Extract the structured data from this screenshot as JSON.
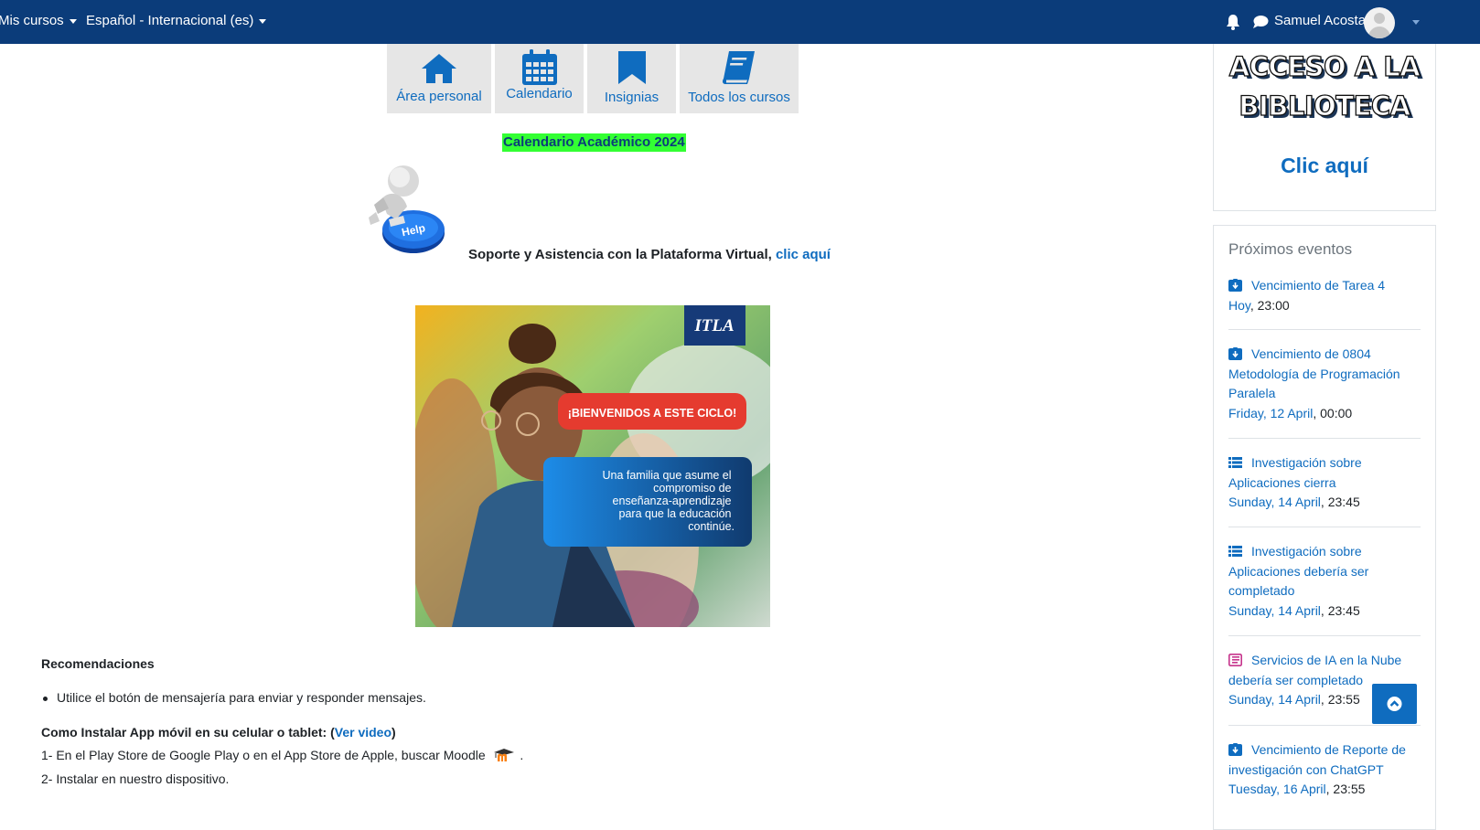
{
  "navbar": {
    "my_courses": "Mis cursos",
    "language": "Español - Internacional (es)",
    "user_name": "Samuel Acosta"
  },
  "quick_links": [
    {
      "label": "Área personal",
      "icon": "home-icon"
    },
    {
      "label": "Calendario",
      "icon": "calendar-icon"
    },
    {
      "label": "Insignias",
      "icon": "bookmark-icon"
    },
    {
      "label": "Todos los cursos",
      "icon": "book-icon"
    }
  ],
  "calendar_link": "Calendario Académico 2024",
  "support": {
    "help_badge": "Help",
    "text": "Soporte y Asistencia con la Plataforma Virtual,",
    "link": "clic aquí"
  },
  "banner": {
    "logo": "ITLA",
    "welcome": "¡BIENVENIDOS A ESTE CICLO!",
    "tagline_lines": [
      "Una familia que asume el",
      "compromiso de",
      "enseñanza-aprendizaje",
      "para que la educación",
      "continúe."
    ]
  },
  "recommendations": {
    "heading": "Recomendaciones",
    "items": [
      "Utilice el botón de mensajería para enviar y responder mensajes."
    ],
    "app_heading_prefix": "Como Instalar App móvil en su celular o tablet: (",
    "app_heading_link": "Ver video",
    "app_heading_suffix": ")",
    "step1": "1- En el Play Store de Google Play o en el App Store de Apple, buscar Moodle",
    "step1_end": ".",
    "step2": "2- Instalar en nuestro dispositivo."
  },
  "library_block": {
    "line1": "ACCESO A LA",
    "line2": "BIBLIOTECA",
    "link": "Clic aquí"
  },
  "events": {
    "title": "Próximos eventos",
    "items": [
      {
        "icon": "assignment-icon",
        "title": "Vencimiento de Tarea 4",
        "date": "Hoy",
        "time": ", 23:00"
      },
      {
        "icon": "assignment-icon",
        "title": "Vencimiento de 0804 Metodología de Programación Paralela",
        "date": "Friday, 12 April",
        "time": ", 00:00"
      },
      {
        "icon": "feedback-icon",
        "title": "Investigación sobre Aplicaciones cierra",
        "date": "Sunday, 14 April",
        "time": ", 23:45"
      },
      {
        "icon": "feedback-icon",
        "title": "Investigación sobre Aplicaciones debería ser completado",
        "date": "Sunday, 14 April",
        "time": ", 23:45"
      },
      {
        "icon": "lesson-icon",
        "title": "Servicios de IA en la Nube debería ser completado",
        "date": "Sunday, 14 April",
        "time": ", 23:55"
      },
      {
        "icon": "assignment-icon",
        "title": "Vencimiento de Reporte de investigación con ChatGPT",
        "date": "Tuesday, 16 April",
        "time": ", 23:55"
      }
    ]
  },
  "colors": {
    "navbar": "#0b3c7a",
    "link": "#0f6cbf",
    "highlight": "#33ff33",
    "lesson_icon": "#c6348c"
  }
}
